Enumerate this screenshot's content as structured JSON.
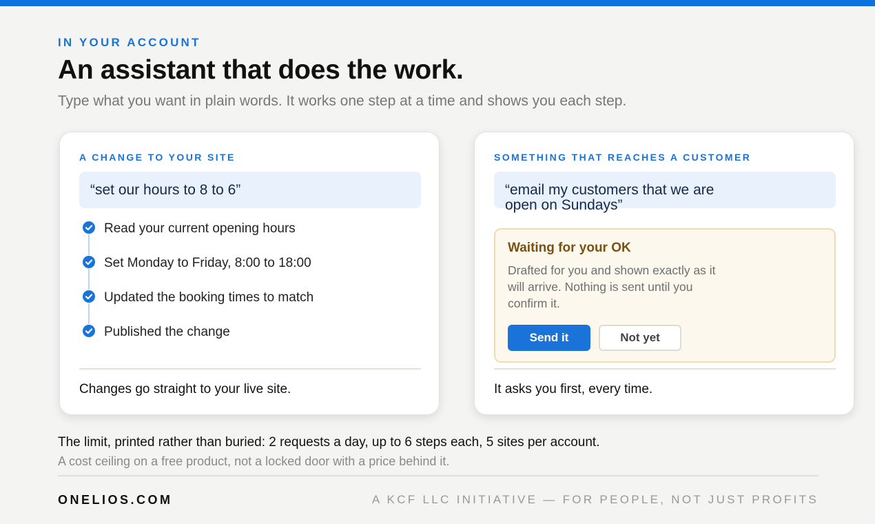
{
  "colors": {
    "accent": "#0b72e0",
    "label_blue": "#1a73d9",
    "prompt_bg": "#e8f1fc",
    "approval_bg": "#fdf8ee",
    "approval_border": "#efdcae",
    "approval_title": "#7a5114"
  },
  "header": {
    "eyebrow": "IN YOUR ACCOUNT",
    "headline": "An assistant that does the work.",
    "subhead": "Type what you want in plain words. It works one step at a time and shows you each step."
  },
  "card_left": {
    "label": "A CHANGE TO YOUR SITE",
    "prompt": "“set our hours to 8 to 6”",
    "step_icon": "check-circle-icon",
    "steps": [
      {
        "text": "Read your current opening hours"
      },
      {
        "text": "Set Monday to Friday, 8:00 to 18:00"
      },
      {
        "text": "Updated the booking times to match"
      },
      {
        "text": "Published the change"
      }
    ],
    "footer": "Changes go straight to your live site."
  },
  "card_right": {
    "label": "SOMETHING THAT REACHES A CUSTOMER",
    "prompt_line1": "“email my customers that we are",
    "prompt_line2": "open on Sundays”",
    "approval": {
      "title": "Waiting for your OK",
      "body": "Drafted for you and shown exactly as it will arrive. Nothing is sent until you confirm it.",
      "send_label": "Send it",
      "wait_label": "Not yet"
    },
    "footer": "It asks you first, every time."
  },
  "limit": {
    "main": "The limit, printed rather than buried: 2 requests a day, up to 6 steps each, 5 sites per account.",
    "sub": "A cost ceiling on a free product, not a locked door with a price behind it."
  },
  "footer": {
    "brand": "ONELIOS.COM",
    "tagline": "A KCF LLC INITIATIVE — FOR PEOPLE, NOT JUST PROFITS"
  }
}
